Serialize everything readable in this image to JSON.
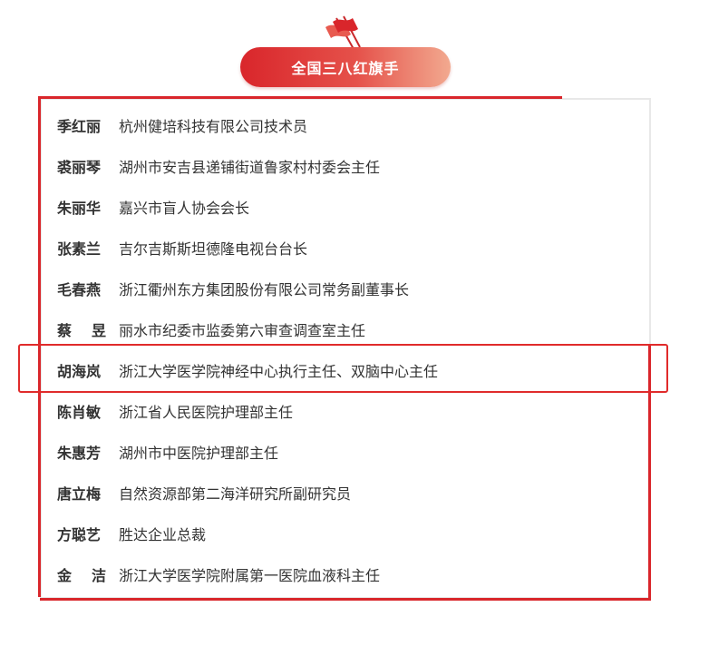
{
  "header": {
    "title": "全国三八红旗手",
    "icon": "flags-icon",
    "accent_color": "#d9262b"
  },
  "list": [
    {
      "name": "季红丽",
      "role": "杭州健培科技有限公司技术员"
    },
    {
      "name": "裘丽琴",
      "role": "湖州市安吉县递铺街道鲁家村村委会主任"
    },
    {
      "name": "朱丽华",
      "role": "嘉兴市盲人协会会长"
    },
    {
      "name": "张素兰",
      "role": "吉尔吉斯斯坦德隆电视台台长"
    },
    {
      "name": "毛春燕",
      "role": "浙江衢州东方集团股份有限公司常务副董事长"
    },
    {
      "name": "蔡昱",
      "role": "丽水市纪委市监委第六审查调查室主任"
    },
    {
      "name": "胡海岚",
      "role": "浙江大学医学院神经中心执行主任、双脑中心主任"
    },
    {
      "name": "陈肖敏",
      "role": "浙江省人民医院护理部主任"
    },
    {
      "name": "朱惠芳",
      "role": "湖州市中医院护理部主任"
    },
    {
      "name": "唐立梅",
      "role": "自然资源部第二海洋研究所副研究员"
    },
    {
      "name": "方聪艺",
      "role": "胜达企业总裁"
    },
    {
      "name": "金洁",
      "role": "浙江大学医学院附属第一医院血液科主任"
    }
  ],
  "highlight_color": "#e02b2b"
}
